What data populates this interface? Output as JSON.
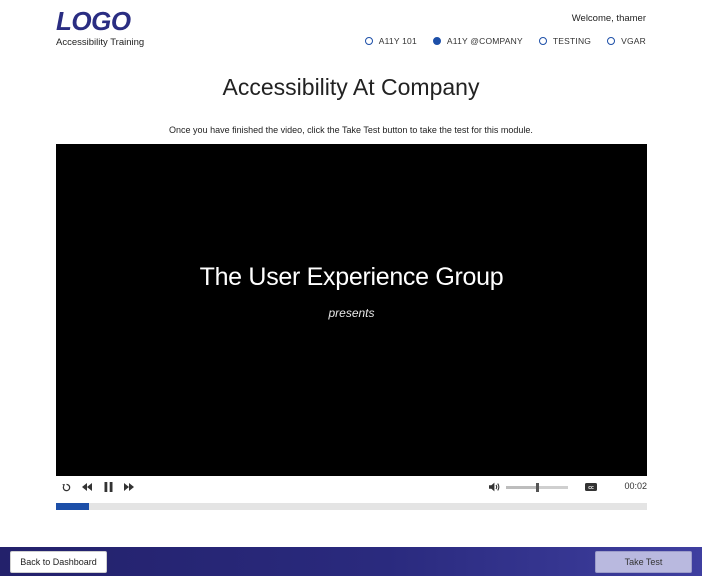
{
  "header": {
    "logo": "LOGO",
    "subtitle": "Accessibility Training",
    "welcome": "Welcome, thamer",
    "modules": [
      {
        "label": "A11Y 101",
        "selected": false
      },
      {
        "label": "A11Y @COMPANY",
        "selected": true
      },
      {
        "label": "TESTING",
        "selected": false
      },
      {
        "label": "VGAR",
        "selected": false
      }
    ]
  },
  "main": {
    "title": "Accessibility At Company",
    "instructions": "Once you have finished the video, click the Take Test button to take the test for this module."
  },
  "video": {
    "title": "The User Experience Group",
    "subtitle": "presents",
    "time": "00:02",
    "progress_fraction": 0.056,
    "volume_fraction": 0.5,
    "icons": {
      "replay": "replay-icon",
      "rewind": "rewind-icon",
      "pause": "pause-icon",
      "forward": "fast-forward-icon",
      "volume": "volume-icon",
      "captions": "closed-captions-icon"
    }
  },
  "footer": {
    "back_label": "Back to Dashboard",
    "test_label": "Take Test"
  },
  "colors": {
    "brand": "#2a2d82",
    "accent": "#1d4fa8",
    "footer": "#23216b",
    "disabled_button": "#b9b9df"
  }
}
